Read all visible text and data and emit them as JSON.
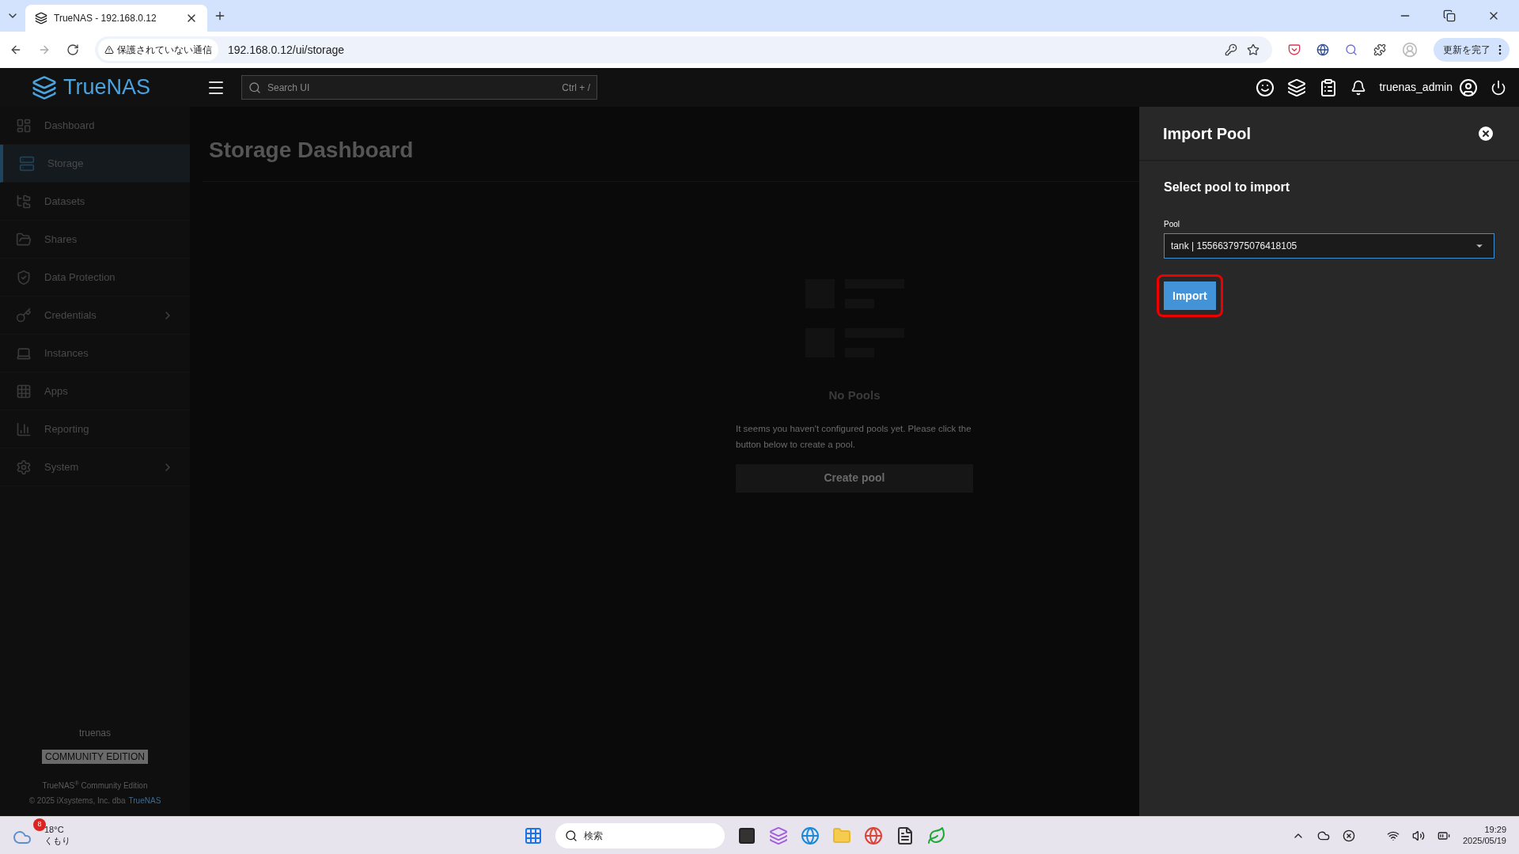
{
  "browser": {
    "tab_title": "TrueNAS - 192.168.0.12",
    "security_label": "保護されていない通信",
    "url": "192.168.0.12/ui/storage",
    "update_button": "更新を完了"
  },
  "header": {
    "logo": "TrueNAS",
    "search": {
      "placeholder": "Search UI",
      "shortcut": "Ctrl + /"
    },
    "username": "truenas_admin"
  },
  "sidebar": {
    "items": [
      {
        "label": "Dashboard",
        "selected": false,
        "has_submenu": false
      },
      {
        "label": "Storage",
        "selected": true,
        "has_submenu": false
      },
      {
        "label": "Datasets",
        "selected": false,
        "has_submenu": false
      },
      {
        "label": "Shares",
        "selected": false,
        "has_submenu": false
      },
      {
        "label": "Data Protection",
        "selected": false,
        "has_submenu": false
      },
      {
        "label": "Credentials",
        "selected": false,
        "has_submenu": true
      },
      {
        "label": "Instances",
        "selected": false,
        "has_submenu": false
      },
      {
        "label": "Apps",
        "selected": false,
        "has_submenu": false
      },
      {
        "label": "Reporting",
        "selected": false,
        "has_submenu": false
      },
      {
        "label": "System",
        "selected": false,
        "has_submenu": true
      }
    ],
    "footer": {
      "hostname": "truenas",
      "edition_badge": "COMMUNITY EDITION",
      "product": "TrueNAS$^{®}$ Community Edition",
      "copyright": "© 2025 iXsystems, Inc. dba",
      "copyright_link": "TrueNAS"
    }
  },
  "page": {
    "title": "Storage Dashboard",
    "empty_state": {
      "title": "No Pools",
      "message": "It seems you haven't configured pools yet. Please click the button below to create a pool.",
      "button": "Create pool"
    }
  },
  "import_panel": {
    "title": "Import Pool",
    "subtitle": "Select pool to import",
    "field_label": "Pool",
    "value": "tank | 1556637975076418105",
    "button": "Import",
    "highlighted": true
  },
  "taskbar": {
    "weather_temp": "18°C",
    "weather_text": "くもり",
    "weather_badge": "8",
    "search_placeholder": "検索",
    "time": "19:29",
    "date": "2025/05/19"
  }
}
